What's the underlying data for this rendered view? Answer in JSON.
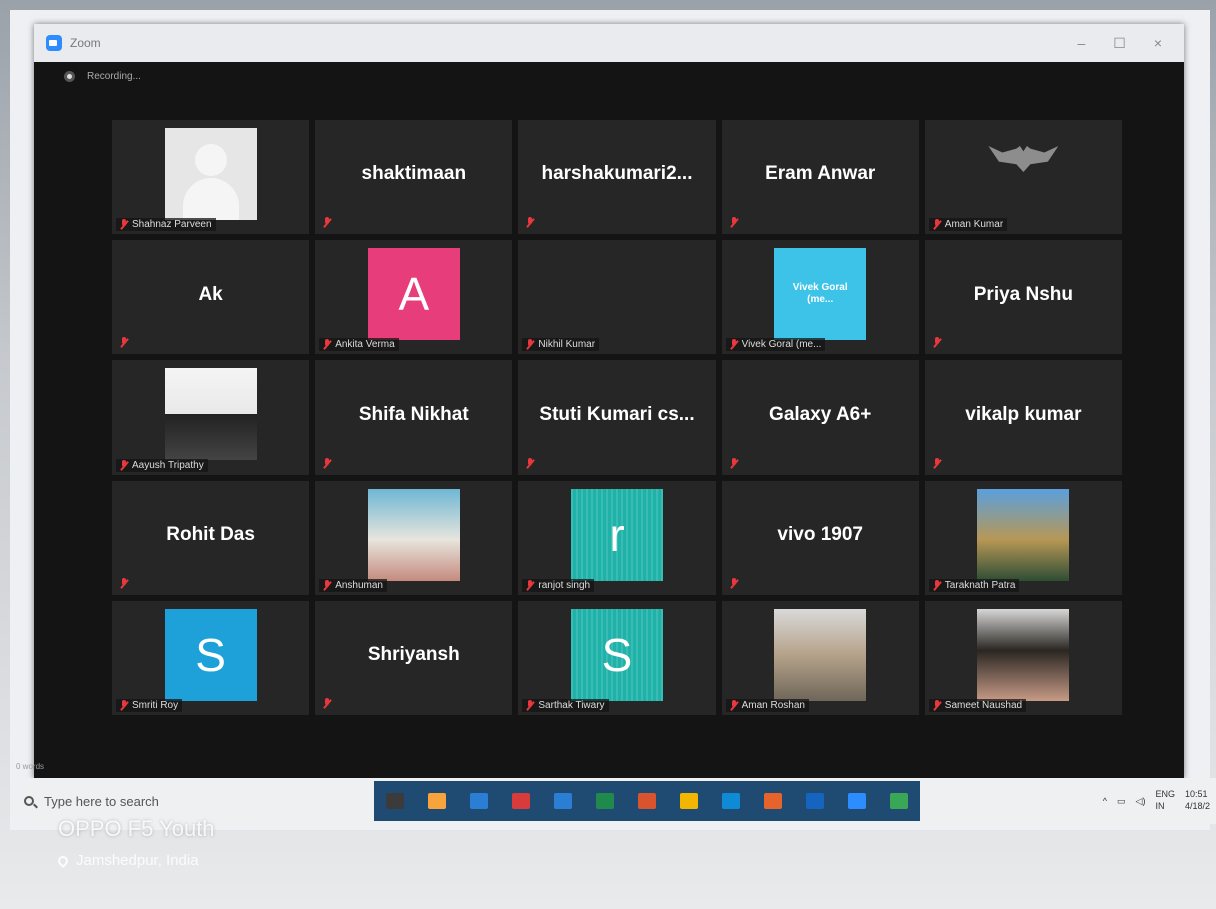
{
  "window": {
    "title": "Zoom",
    "controls": [
      "–",
      "☐",
      "×"
    ],
    "recording_label": "Recording..."
  },
  "participants": [
    {
      "display": "",
      "label": "Shahnaz Parveen",
      "avatar": "silhouette"
    },
    {
      "display": "shaktimaan",
      "label": "",
      "avatar": "none"
    },
    {
      "display": "harshakumari2...",
      "label": "",
      "avatar": "none"
    },
    {
      "display": "Eram Anwar",
      "label": "",
      "avatar": "none"
    },
    {
      "display": "",
      "label": "Aman Kumar",
      "avatar": "bat-logo"
    },
    {
      "display": "Ak",
      "label": "",
      "avatar": "none"
    },
    {
      "display": "A",
      "label": "Ankita Verma",
      "avatar": "pink-letter"
    },
    {
      "display": "",
      "label": "Nikhil Kumar",
      "avatar": "photo-a"
    },
    {
      "display": "Vivek Goral (me...",
      "label": "Vivek Goral (me...",
      "avatar": "cyan-text"
    },
    {
      "display": "Priya Nshu",
      "label": "",
      "avatar": "none"
    },
    {
      "display": "",
      "label": "Aayush Tripathy",
      "avatar": "photo-b"
    },
    {
      "display": "Shifa Nikhat",
      "label": "",
      "avatar": "none"
    },
    {
      "display": "Stuti Kumari cs...",
      "label": "",
      "avatar": "none"
    },
    {
      "display": "Galaxy A6+",
      "label": "",
      "avatar": "none"
    },
    {
      "display": "vikalp kumar",
      "label": "",
      "avatar": "none"
    },
    {
      "display": "Rohit Das",
      "label": "",
      "avatar": "none"
    },
    {
      "display": "",
      "label": "Anshuman",
      "avatar": "photo-c"
    },
    {
      "display": "r",
      "label": "ranjot singh",
      "avatar": "teal-letter"
    },
    {
      "display": "vivo 1907",
      "label": "",
      "avatar": "none"
    },
    {
      "display": "",
      "label": "Taraknath Patra",
      "avatar": "photo-d"
    },
    {
      "display": "S",
      "label": "Smriti Roy",
      "avatar": "blue-letter"
    },
    {
      "display": "Shriyansh",
      "label": "",
      "avatar": "none"
    },
    {
      "display": "S",
      "label": "Sarthak Tiwary",
      "avatar": "teal-letter"
    },
    {
      "display": "",
      "label": "Aman Roshan",
      "avatar": "photo-e"
    },
    {
      "display": "",
      "label": "Sameet Naushad",
      "avatar": "photo-f"
    }
  ],
  "taskbar": {
    "search_placeholder": "Type here to search",
    "word_count": "0 words",
    "app_colors": [
      "#3b3b3b",
      "#f6a43b",
      "#2a7fd4",
      "#d93a3a",
      "#2a7fd4",
      "#1f8a4c",
      "#d9532e",
      "#f2b600",
      "#0f8bd6",
      "#e7632c",
      "#1565c0",
      "#2d8cff",
      "#3aa757"
    ],
    "tray": {
      "lang": "ENG",
      "region": "IN",
      "time": "10:51",
      "date": "4/18/2"
    }
  },
  "photo_overlay": {
    "device": "OPPO F5 Youth",
    "location": "Jamshedpur, India"
  }
}
